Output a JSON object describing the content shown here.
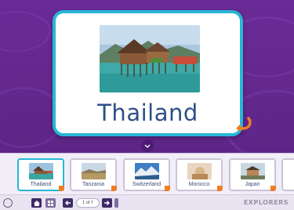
{
  "main_card": {
    "title": "Thailand",
    "image_icon": "stilt-house-photo",
    "flip_icon": "turn-arrow-icon"
  },
  "thumbnails": [
    {
      "label": "Thailand",
      "active": true
    },
    {
      "label": "Tanzania",
      "active": false
    },
    {
      "label": "Switzerland",
      "active": false
    },
    {
      "label": "Morocco",
      "active": false
    },
    {
      "label": "Japan",
      "active": false
    }
  ],
  "toolbar": {
    "page_indicator": "1 of 7",
    "brand": "EXPLORERS",
    "buttons": [
      "settings-icon",
      "home-icon",
      "grid-icon",
      "prev-icon",
      "next-icon",
      "more-icon"
    ]
  },
  "colors": {
    "background": "#6a2a94",
    "card_border": "#27b7d6",
    "title": "#2e4f86",
    "accent": "#ef7d24"
  }
}
